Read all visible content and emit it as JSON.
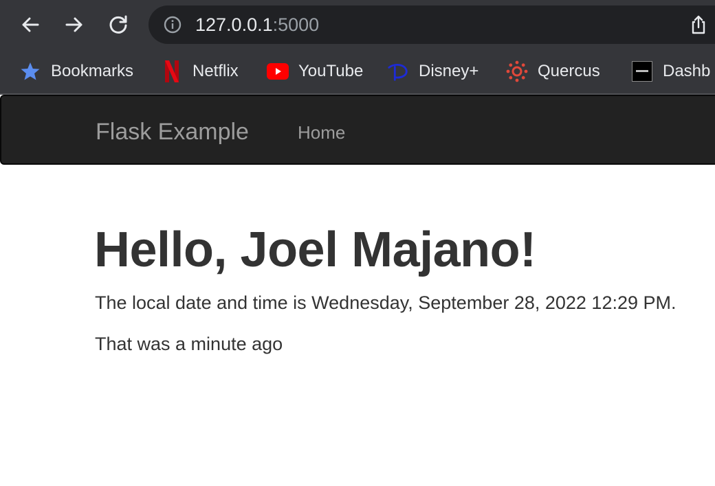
{
  "browser": {
    "url_host": "127.0.0.1",
    "url_port": ":5000",
    "toolbar_icons": [
      "back-arrow-icon",
      "forward-arrow-icon",
      "reload-icon",
      "info-icon",
      "share-icon"
    ]
  },
  "bookmarks": {
    "items": [
      {
        "label": "Bookmarks",
        "icon": "star-icon"
      },
      {
        "label": "Netflix",
        "icon": "netflix-icon"
      },
      {
        "label": "YouTube",
        "icon": "youtube-icon"
      },
      {
        "label": "Disney+",
        "icon": "disney-plus-icon"
      },
      {
        "label": "Quercus",
        "icon": "quercus-icon"
      },
      {
        "label": "Dashb",
        "icon": "dashboard-icon"
      }
    ]
  },
  "navbar": {
    "brand": "Flask Example",
    "links": [
      "Home"
    ]
  },
  "main": {
    "greeting": "Hello, Joel Majano!",
    "datetime_text": "The local date and time is Wednesday, September 28, 2022 12:29 PM.",
    "relative_text": "That was a minute ago"
  },
  "colors": {
    "browser_chrome": "#35363a",
    "omnibox": "#202124",
    "navbar_bg": "#222222",
    "navbar_text": "#9d9d9d",
    "body_text": "#333333"
  }
}
